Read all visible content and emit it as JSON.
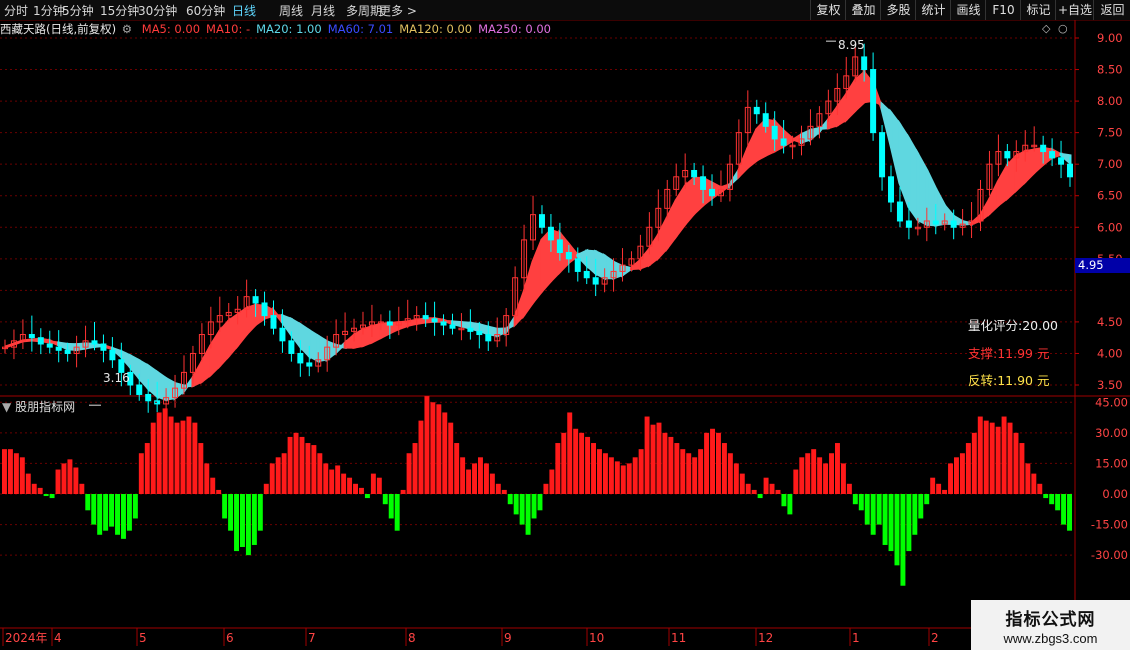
{
  "toolbar": {
    "left_items": [
      "分时",
      "1分钟",
      "5分钟",
      "15分钟",
      "30分钟",
      "60分钟",
      "日线",
      "周线",
      "月线",
      "多周期",
      "更多 >"
    ],
    "active": "日线",
    "right_items": [
      "复权",
      "叠加",
      "多股",
      "统计",
      "画线",
      "F10",
      "标记",
      "+自选",
      "返回"
    ]
  },
  "info_bar": {
    "stock": "西藏天路(日线,前复权)",
    "ma": [
      {
        "label": "MA5: 0.00",
        "color": "#ff3b3b"
      },
      {
        "label": "MA10: -",
        "color": "#ff3b3b"
      },
      {
        "label": "MA20: 1.00",
        "color": "#5fd7e8"
      },
      {
        "label": "MA60: 7.01",
        "color": "#3a4bff"
      },
      {
        "label": "MA120: 0.00",
        "color": "#e0c060"
      },
      {
        "label": "MA250: 0.00",
        "color": "#e070e0"
      }
    ]
  },
  "price_axis": {
    "labels": [
      "9.00",
      "8.50",
      "8.00",
      "7.50",
      "7.00",
      "6.50",
      "6.00",
      "5.50",
      "4.95",
      "4.50",
      "4.00",
      "3.50"
    ],
    "current": "4.95"
  },
  "annotations": {
    "high": "8.95",
    "low": "3.16"
  },
  "scores": {
    "quant_label": "量化评分:20.00",
    "support_label": "支撑:11.99 元",
    "reverse_label": "反转:11.90 元"
  },
  "sub_chart": {
    "title": "股朋指标网",
    "axis_labels": [
      "45.00",
      "30.00",
      "15.00",
      "0.00",
      "-15.00",
      "-30.00"
    ]
  },
  "time_axis": {
    "labels": [
      "2024年",
      "4",
      "5",
      "6",
      "7",
      "8",
      "9",
      "10",
      "11",
      "12",
      "1",
      "2"
    ]
  },
  "watermark": {
    "line1": "指标公式网",
    "line2": "www.zbgs3.com"
  },
  "colors": {
    "up": "#ff3333",
    "down": "#00ffff",
    "bar_up": "#ff1a1a",
    "bar_down": "#00ff00",
    "ribbon_up": "#ff4040",
    "ribbon_down": "#5fd7e0",
    "grid": "#6a0000"
  },
  "chart_data": {
    "type": "bar",
    "price_series_close": [
      4.1,
      4.2,
      4.3,
      4.25,
      4.15,
      4.1,
      4.05,
      4.0,
      4.1,
      4.2,
      4.15,
      4.05,
      3.9,
      3.7,
      3.5,
      3.35,
      3.25,
      3.2,
      3.3,
      3.45,
      3.7,
      4.0,
      4.3,
      4.5,
      4.6,
      4.65,
      4.7,
      4.9,
      4.8,
      4.6,
      4.4,
      4.2,
      4.0,
      3.85,
      3.8,
      3.9,
      4.1,
      4.3,
      4.35,
      4.4,
      4.45,
      4.5,
      4.5,
      4.45,
      4.5,
      4.55,
      4.6,
      4.55,
      4.5,
      4.45,
      4.4,
      4.4,
      4.35,
      4.3,
      4.2,
      4.3,
      4.6,
      5.2,
      5.8,
      6.2,
      6.0,
      5.8,
      5.6,
      5.5,
      5.3,
      5.2,
      5.1,
      5.2,
      5.3,
      5.4,
      5.5,
      5.7,
      6.0,
      6.3,
      6.6,
      6.8,
      6.9,
      6.8,
      6.6,
      6.5,
      6.6,
      7.0,
      7.5,
      7.9,
      7.8,
      7.6,
      7.4,
      7.3,
      7.3,
      7.4,
      7.6,
      7.8,
      8.0,
      8.2,
      8.4,
      8.7,
      8.5,
      7.5,
      6.8,
      6.4,
      6.1,
      6.0,
      6.0,
      6.1,
      6.05,
      6.1,
      6.0,
      6.05,
      6.1,
      6.6,
      7.0,
      7.2,
      7.1,
      7.2,
      7.3,
      7.3,
      7.2,
      7.1,
      7.0,
      6.8
    ],
    "indicator_values": [
      22,
      22,
      20,
      18,
      10,
      5,
      3,
      -1,
      -2,
      12,
      15,
      17,
      13,
      5,
      -8,
      -15,
      -20,
      -18,
      -16,
      -20,
      -22,
      -18,
      -12,
      20,
      25,
      35,
      40,
      42,
      38,
      35,
      36,
      38,
      35,
      25,
      15,
      8,
      2,
      -12,
      -18,
      -28,
      -26,
      -30,
      -25,
      -18,
      5,
      15,
      18,
      20,
      28,
      30,
      28,
      25,
      24,
      20,
      15,
      12,
      14,
      10,
      8,
      5,
      3,
      -2,
      10,
      8,
      -5,
      -12,
      -18,
      2,
      20,
      25,
      36,
      48,
      45,
      44,
      40,
      35,
      25,
      18,
      12,
      15,
      18,
      15,
      10,
      5,
      2,
      -5,
      -10,
      -15,
      -20,
      -12,
      -8,
      5,
      12,
      25,
      30,
      40,
      32,
      30,
      28,
      25,
      22,
      20,
      18,
      16,
      14,
      15,
      18,
      22,
      38,
      34,
      35,
      30,
      28,
      25,
      22,
      20,
      18,
      22,
      30,
      32,
      30,
      25,
      20,
      15,
      10,
      5,
      2,
      -2,
      8,
      5,
      2,
      -6,
      -10,
      12,
      18,
      20,
      22,
      18,
      15,
      20,
      25,
      15,
      5,
      -5,
      -8,
      -15,
      -20,
      -15,
      -25,
      -28,
      -35,
      -45,
      -28,
      -20,
      -12,
      -5,
      8,
      5,
      2,
      15,
      18,
      20,
      25,
      30,
      38,
      36,
      35,
      33,
      38,
      35,
      30,
      25,
      15,
      10,
      5,
      -2,
      -5,
      -8,
      -15,
      -18
    ]
  }
}
